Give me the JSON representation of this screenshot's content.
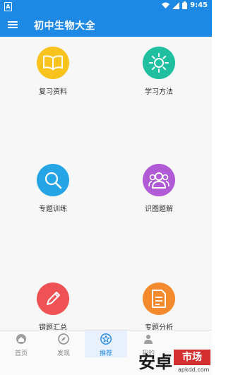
{
  "status_bar": {
    "time": "9:45",
    "left_icon_letter": "A"
  },
  "app_bar": {
    "title": "初中生物大全"
  },
  "grid": {
    "items": [
      {
        "label": "复习资料",
        "color": "#f7c31c",
        "icon": "book-icon"
      },
      {
        "label": "学习方法",
        "color": "#1fbfa0",
        "icon": "sun-icon"
      },
      {
        "label": "专题训练",
        "color": "#26a5e6",
        "icon": "search-icon"
      },
      {
        "label": "识图题解",
        "color": "#b05ad6",
        "icon": "group-icon"
      },
      {
        "label": "错题汇总",
        "color": "#ef5254",
        "icon": "pencil-icon"
      },
      {
        "label": "专题分析",
        "color": "#f38a2e",
        "icon": "document-icon"
      }
    ]
  },
  "tab_bar": {
    "tabs": [
      {
        "label": "首页",
        "icon": "home-icon",
        "active": false
      },
      {
        "label": "发现",
        "icon": "compass-icon",
        "active": false
      },
      {
        "label": "推荐",
        "icon": "star-icon",
        "active": true
      },
      {
        "label": "我的",
        "icon": "user-icon",
        "active": false
      }
    ]
  },
  "watermark": {
    "main": "安卓",
    "badge": "市场",
    "sub": "apkdd.com"
  },
  "colors": {
    "primary": "#1e88e5"
  }
}
